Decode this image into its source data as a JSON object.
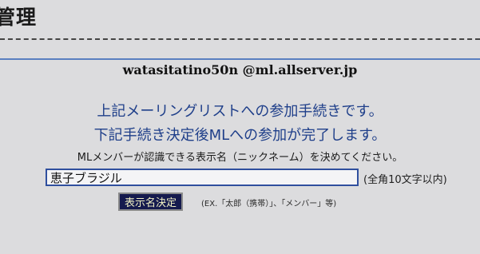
{
  "header": {
    "title": "管理"
  },
  "list": {
    "address": "watasitatino50n @ml.allserver.jp"
  },
  "messages": {
    "line1": "上記メーリングリストへの参加手続きです。",
    "line2": "下記手続き決定後MLへの参加が完了します。",
    "instruction": "MLメンバーが認識できる表示名（ニックネーム）を決めてください。"
  },
  "form": {
    "display_name_value": "恵子ブラジル",
    "length_note": "(全角10文字以内)",
    "submit_label": "表示名決定",
    "example_text": "(EX.「太郎（携帯）」、「メンバー」等)"
  },
  "colors": {
    "accent_blue": "#1f3f8a",
    "button_bg": "#151a4e",
    "button_text": "#f2f2c4",
    "rule_blue": "#5a7fc0"
  }
}
